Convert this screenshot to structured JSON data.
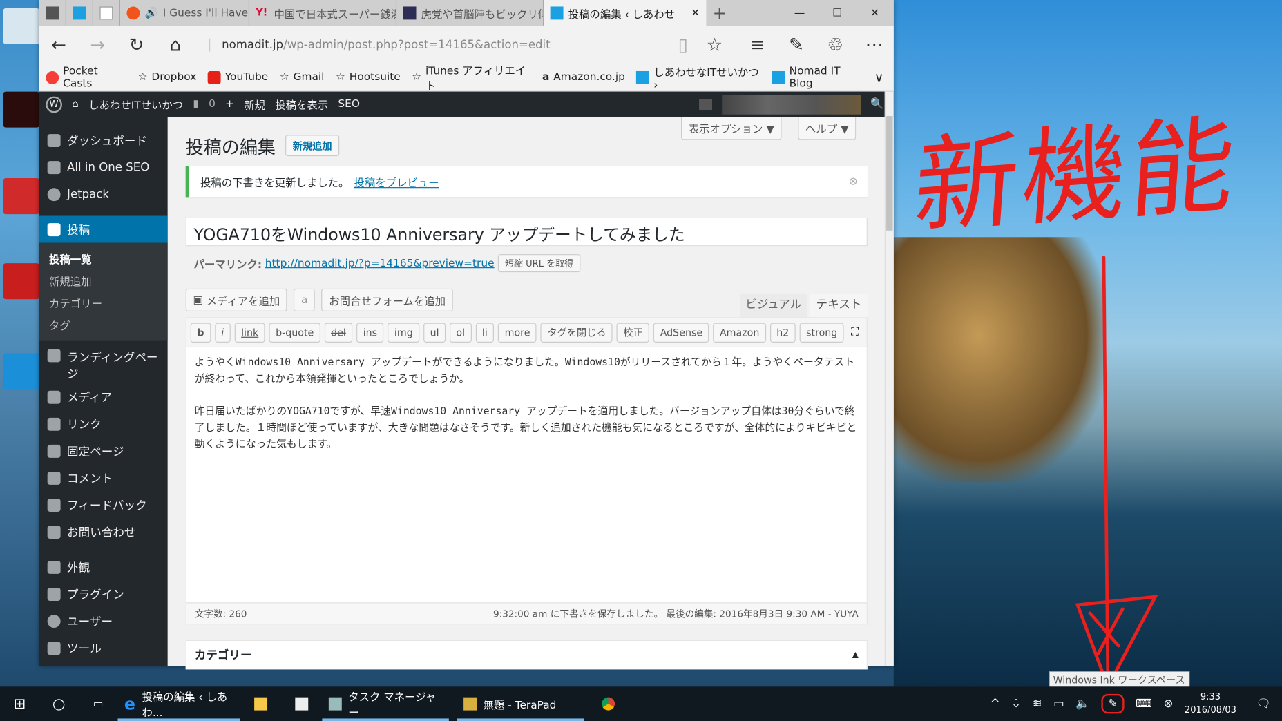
{
  "browser": {
    "tabs": [
      {
        "label": "",
        "icon": "app-icon"
      },
      {
        "label": "",
        "icon": "blog-icon"
      },
      {
        "label": "",
        "icon": "amazon-icon"
      },
      {
        "label": "I Guess I'll Have to",
        "icon": "music-icon"
      },
      {
        "label": "中国で日本式スーパー銭湯",
        "icon": "yahoo-icon"
      },
      {
        "label": "虎党や首脳陣もビックリ仰",
        "icon": "y-icon"
      },
      {
        "label": "投稿の編集 ‹ しあわせ",
        "icon": "blog-icon",
        "active": true
      }
    ],
    "url_host": "nomadit.jp",
    "url_path": "/wp-admin/post.php?post=14165&action=edit",
    "favorites": [
      "Pocket Casts",
      "Dropbox",
      "YouTube",
      "Gmail",
      "Hootsuite",
      "iTunes アフィリエイト",
      "Amazon.co.jp",
      "しあわせなITせいかつ ›",
      "Nomad IT Blog"
    ]
  },
  "wpbar": {
    "site": "しあわせITせいかつ",
    "comments": "0",
    "new": "新規",
    "view": "投稿を表示",
    "seo": "SEO"
  },
  "sidebar": {
    "items": [
      {
        "label": "ダッシュボード"
      },
      {
        "label": "All in One SEO"
      },
      {
        "label": "Jetpack"
      },
      {
        "label": "投稿",
        "current": true
      },
      {
        "label": "ランディングページ"
      },
      {
        "label": "メディア"
      },
      {
        "label": "リンク"
      },
      {
        "label": "固定ページ"
      },
      {
        "label": "コメント"
      },
      {
        "label": "フィードバック"
      },
      {
        "label": "お問い合わせ"
      },
      {
        "label": "外観"
      },
      {
        "label": "プラグイン"
      },
      {
        "label": "ユーザー"
      },
      {
        "label": "ツール"
      }
    ],
    "submenu": [
      "投稿一覧",
      "新規追加",
      "カテゴリー",
      "タグ"
    ]
  },
  "main": {
    "screen_options": "表示オプション ▼",
    "help": "ヘルプ ▼",
    "title": "投稿の編集",
    "add_new": "新規追加",
    "notice": "投稿の下書きを更新しました。",
    "notice_link": "投稿をプレビュー",
    "post_title": "YOGA710をWindows10 Anniversary アップデートしてみました",
    "permalink_label": "パーマリンク:",
    "permalink": "http://nomadit.jp/?p=14165&preview=true",
    "shortlink": "短縮 URL を取得",
    "add_media": "メディアを追加",
    "amazon_btn": "a",
    "contact_form": "お問合せフォームを追加",
    "tab_visual": "ビジュアル",
    "tab_text": "テキスト",
    "quicktags": [
      "b",
      "i",
      "link",
      "b-quote",
      "del",
      "ins",
      "img",
      "ul",
      "ol",
      "li",
      "more",
      "タグを閉じる",
      "校正",
      "AdSense",
      "Amazon",
      "h2",
      "strong"
    ],
    "content_p1": "ようやくWindows10 Anniversary アップデートができるようになりました。Windows10がリリースされてから１年。ようやくベータテストが終わって、これから本領発揮といったところでしょうか。",
    "content_p2": "昨日届いたばかりのYOGA710ですが、早速Windows10 Anniversary アップデートを適用しました。バージョンアップ自体は30分ぐらいで終了しました。１時間ほど使っていますが、大きな問題はなさそうです。新しく追加された機能も気になるところですが、全体的によりキビキビと動くようになった気もします。",
    "word_count": "文字数: 260",
    "saved": "9:32:00 am に下書きを保存しました。 最後の編集: 2016年8月3日 9:30 AM - YUYA",
    "category_box": "カテゴリー"
  },
  "annotation": {
    "text": "新機能",
    "color": "#e8201e"
  },
  "tooltip": "Windows Ink ワークスペース",
  "taskbar": {
    "apps": [
      {
        "label": "投稿の編集 ‹ しあわ...",
        "open": true
      },
      {
        "label": "",
        "icon": "explorer-icon"
      },
      {
        "label": "",
        "icon": "store-icon"
      },
      {
        "label": "タスク マネージャー",
        "open": true
      },
      {
        "label": "無題 - TeraPad",
        "open": true
      },
      {
        "label": "",
        "icon": "chrome-icon"
      }
    ],
    "time": "9:33",
    "date": "2016/08/03"
  }
}
